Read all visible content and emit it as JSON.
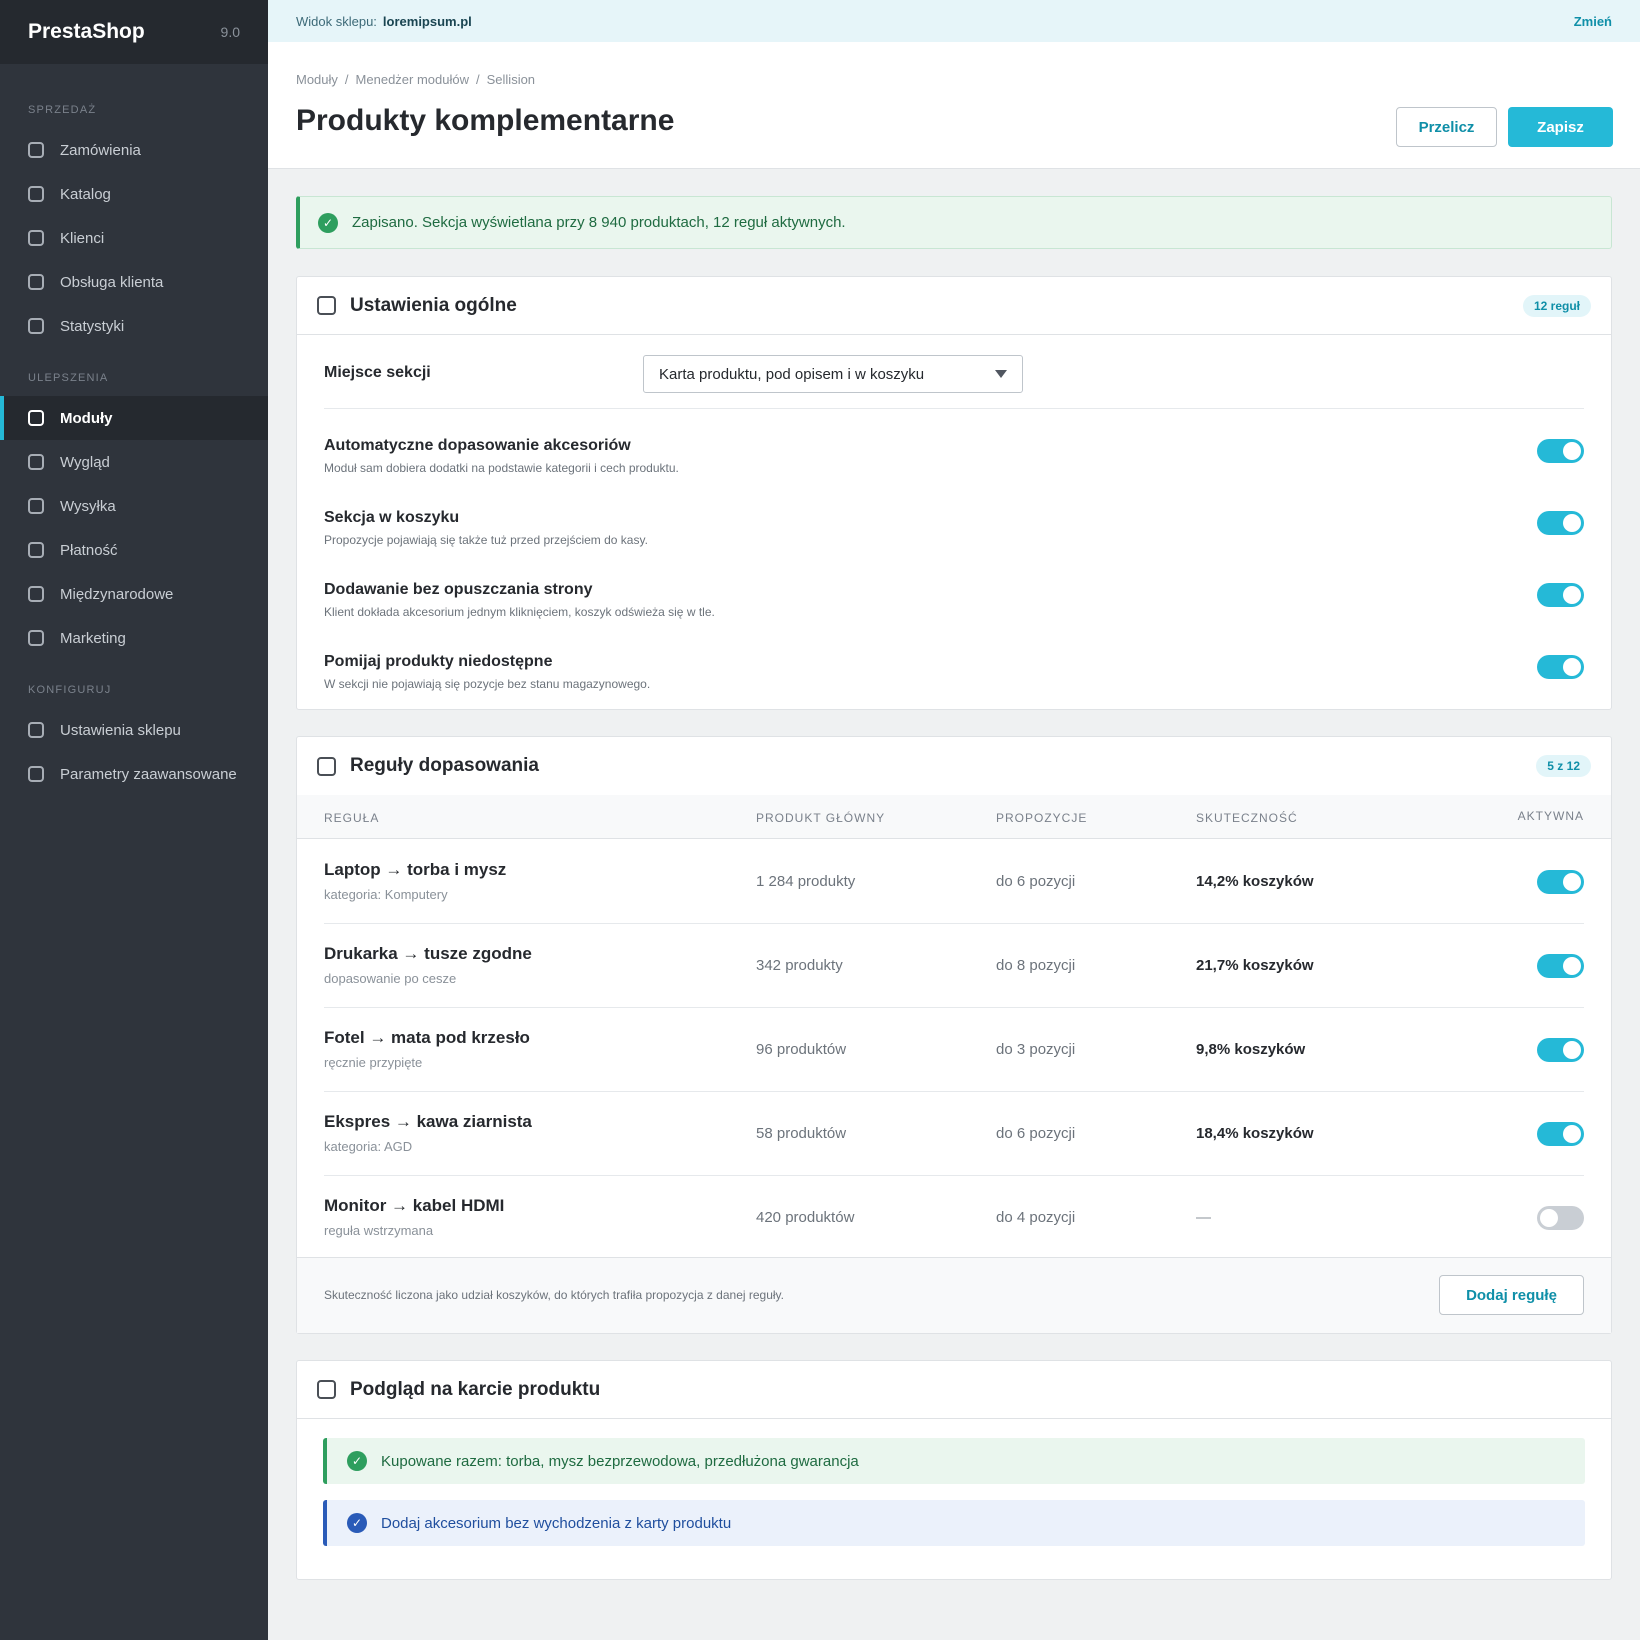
{
  "sidebar": {
    "logo": "PrestaShop",
    "version": "9.0",
    "sections": [
      {
        "title": "SPRZEDAŻ",
        "items": [
          "Zamówienia",
          "Katalog",
          "Klienci",
          "Obsługa klienta",
          "Statystyki"
        ]
      },
      {
        "title": "ULEPSZENIA",
        "items": [
          "Moduły",
          "Wygląd",
          "Wysyłka",
          "Płatność",
          "Międzynarodowe",
          "Marketing"
        ]
      },
      {
        "title": "KONFIGURUJ",
        "items": [
          "Ustawienia sklepu",
          "Parametry zaawansowane"
        ]
      }
    ],
    "active_item": "Moduły"
  },
  "topbar": {
    "label": "Widok sklepu:",
    "shop": "loremipsum.pl",
    "change": "Zmień"
  },
  "breadcrumb": [
    "Moduły",
    "Menedżer modułów",
    "Sellision"
  ],
  "page_title": "Produkty komplementarne",
  "buttons": {
    "recalc": "Przelicz",
    "save": "Zapisz"
  },
  "alert": "Zapisano. Sekcja wyświetlana przy 8 940 produktach, 12 reguł aktywnych.",
  "general": {
    "title": "Ustawienia ogólne",
    "badge": "12 reguł",
    "placement_label": "Miejsce sekcji",
    "placement_value": "Karta produktu, pod opisem i w koszyku",
    "toggles": [
      {
        "label": "Automatyczne dopasowanie akcesoriów",
        "desc": "Moduł sam dobiera dodatki na podstawie kategorii i cech produktu.",
        "on": true
      },
      {
        "label": "Sekcja w koszyku",
        "desc": "Propozycje pojawiają się także tuż przed przejściem do kasy.",
        "on": true
      },
      {
        "label": "Dodawanie bez opuszczania strony",
        "desc": "Klient dokłada akcesorium jednym kliknięciem, koszyk odświeża się w tle.",
        "on": true
      },
      {
        "label": "Pomijaj produkty niedostępne",
        "desc": "W sekcji nie pojawiają się pozycje bez stanu magazynowego.",
        "on": true
      }
    ]
  },
  "rules": {
    "title": "Reguły dopasowania",
    "badge": "5 z 12",
    "columns": [
      "REGUŁA",
      "PRODUKT GŁÓWNY",
      "PROPOZYCJE",
      "SKUTECZNOŚĆ",
      "AKTYWNA"
    ],
    "rows": [
      {
        "name": "Laptop → torba i mysz",
        "sub": "kategoria: Komputery",
        "products": "1 284 produkty",
        "proposals": "do 6 pozycji",
        "effectiveness": "14,2% koszyków",
        "active": true
      },
      {
        "name": "Drukarka → tusze zgodne",
        "sub": "dopasowanie po cesze",
        "products": "342 produkty",
        "proposals": "do 8 pozycji",
        "effectiveness": "21,7% koszyków",
        "active": true
      },
      {
        "name": "Fotel → mata pod krzesło",
        "sub": "ręcznie przypięte",
        "products": "96 produktów",
        "proposals": "do 3 pozycji",
        "effectiveness": "9,8% koszyków",
        "active": true
      },
      {
        "name": "Ekspres → kawa ziarnista",
        "sub": "kategoria: AGD",
        "products": "58 produktów",
        "proposals": "do 6 pozycji",
        "effectiveness": "18,4% koszyków",
        "active": true
      },
      {
        "name": "Monitor → kabel HDMI",
        "sub": "reguła wstrzymana",
        "products": "420 produktów",
        "proposals": "do 4 pozycji",
        "effectiveness": "—",
        "active": false
      }
    ],
    "footer_note": "Skuteczność liczona jako udział koszyków, do których trafiła propozycja z danej reguły.",
    "add_button": "Dodaj regułę"
  },
  "preview": {
    "title": "Podgląd na karcie produktu",
    "success": "Kupowane razem: torba, mysz bezprzewodowa, przedłużona gwarancja",
    "info": "Dodaj akcesorium bez wychodzenia z karty produktu"
  },
  "colors": {
    "accent": "#25b9d7",
    "sidebar": "#2f343c",
    "success": "#2e9e5e",
    "info": "#2a5bb8"
  }
}
